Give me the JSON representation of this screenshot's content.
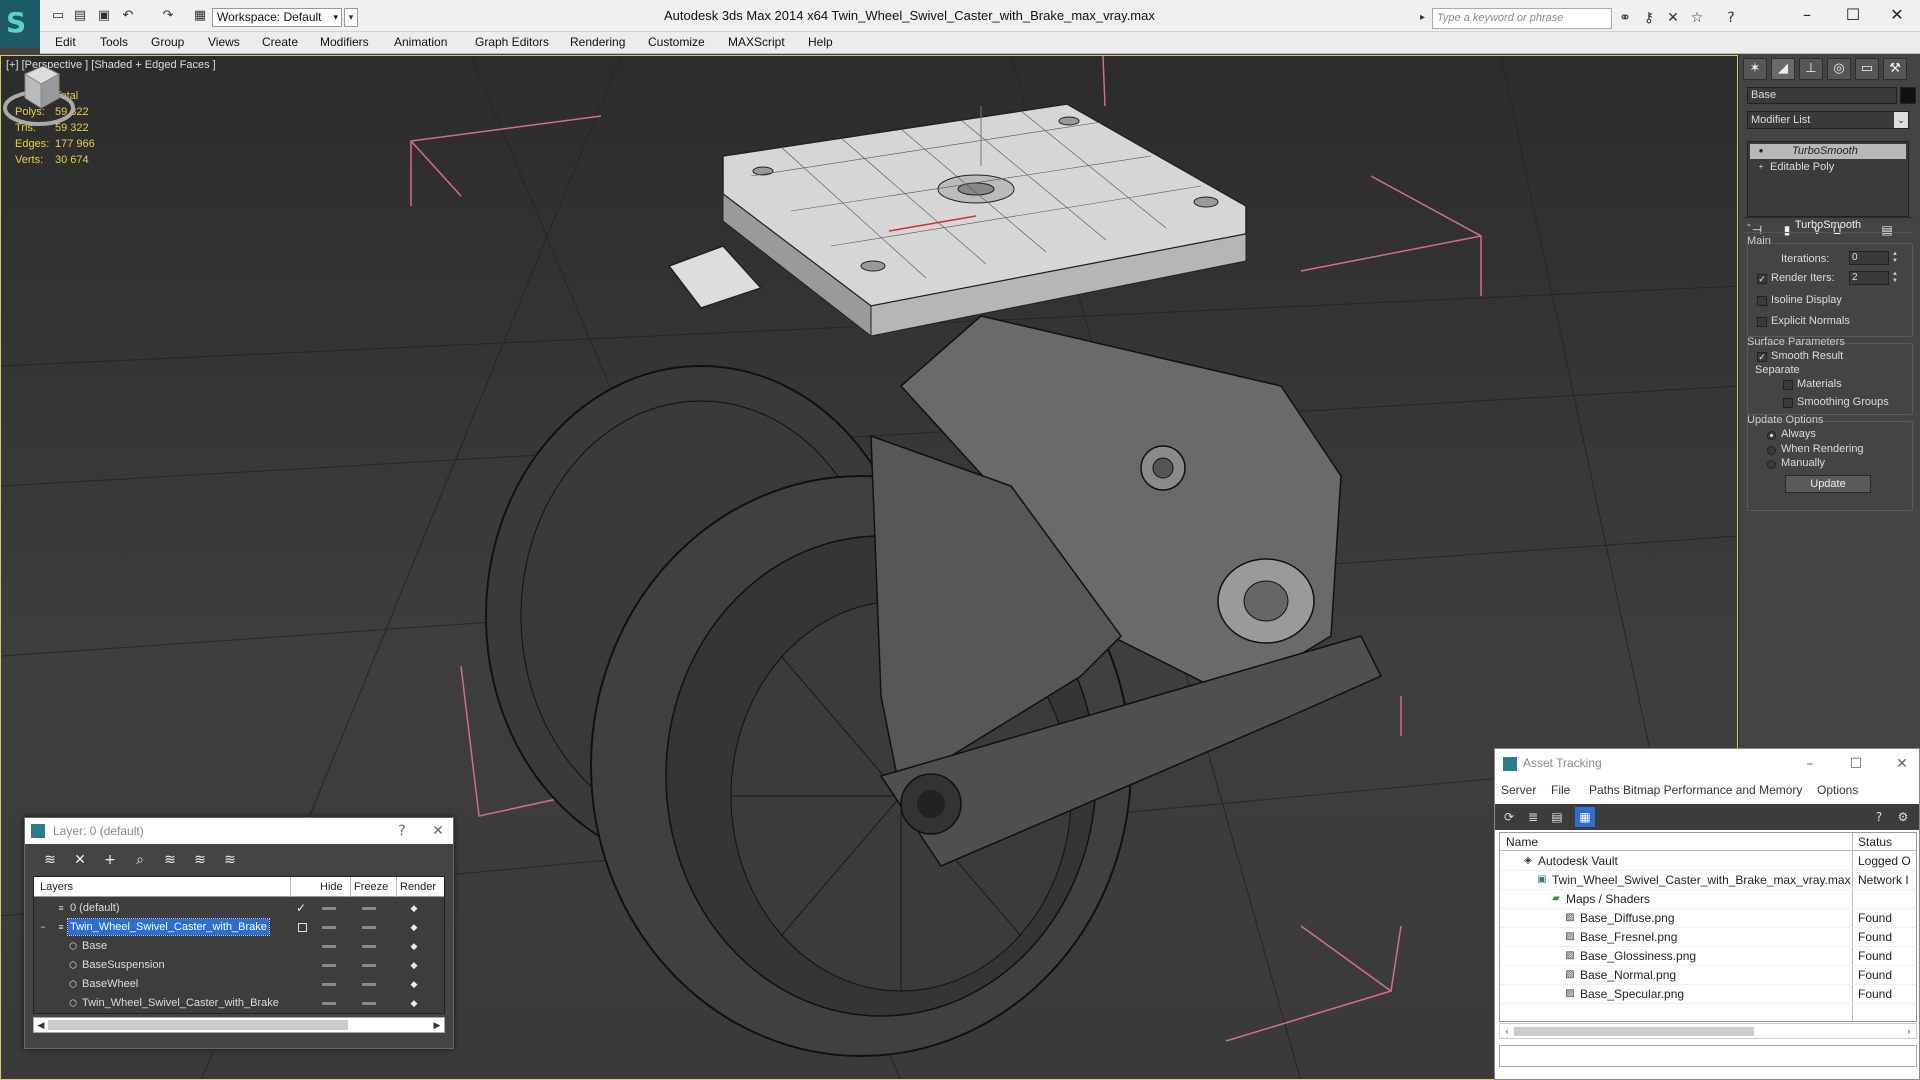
{
  "titlebar": {
    "workspace": "Workspace: Default",
    "title": "Autodesk 3ds Max  2014 x64      Twin_Wheel_Swivel_Caster_with_Brake_max_vray.max",
    "search_placeholder": "Type a keyword or phrase"
  },
  "menu": [
    "Edit",
    "Tools",
    "Group",
    "Views",
    "Create",
    "Modifiers",
    "Animation",
    "Graph Editors",
    "Rendering",
    "Customize",
    "MAXScript",
    "Help"
  ],
  "viewport": {
    "label": "[+] [Perspective ] [Shaded + Edged Faces ]",
    "stats": {
      "header": "Total",
      "rows": [
        {
          "k": "Polys:",
          "v": "59 322"
        },
        {
          "k": "Tris:",
          "v": "59 322"
        },
        {
          "k": "Edges:",
          "v": "177 966"
        },
        {
          "k": "Verts:",
          "v": "30 674"
        }
      ]
    }
  },
  "command_panel": {
    "object_name": "Base",
    "modifier_list": "Modifier List",
    "stack": [
      "TurboSmooth",
      "Editable Poly"
    ],
    "rollout_title": "TurboSmooth",
    "main_label": "Main",
    "iterations_label": "Iterations:",
    "iterations_value": "0",
    "render_iters_label": "Render Iters:",
    "render_iters_value": "2",
    "isoline": "Isoline Display",
    "explicit_normals": "Explicit Normals",
    "surface_params": "Surface Parameters",
    "smooth_result": "Smooth Result",
    "separate": "Separate",
    "materials": "Materials",
    "smoothing_groups": "Smoothing Groups",
    "update_options": "Update Options",
    "always": "Always",
    "when_rendering": "When Rendering",
    "manually": "Manually",
    "update_button": "Update"
  },
  "layer_dialog": {
    "title": "Layer: 0 (default)",
    "help": "?",
    "columns": {
      "layers": "Layers",
      "hide": "Hide",
      "freeze": "Freeze",
      "render": "Render"
    },
    "rows": [
      {
        "name": "0 (default)"
      },
      {
        "name": "Twin_Wheel_Swivel_Caster_with_Brake"
      },
      {
        "name": "Base"
      },
      {
        "name": "BaseSuspension"
      },
      {
        "name": "BaseWheel"
      },
      {
        "name": "Twin_Wheel_Swivel_Caster_with_Brake"
      }
    ]
  },
  "asset_dialog": {
    "title": "Asset Tracking",
    "menu": [
      "Server",
      "File",
      "Paths",
      "Bitmap Performance and Memory",
      "Options"
    ],
    "columns": {
      "name": "Name",
      "status": "Status"
    },
    "rows": [
      {
        "name": "Autodesk Vault",
        "status": "Logged O"
      },
      {
        "name": "Twin_Wheel_Swivel_Caster_with_Brake_max_vray.max",
        "status": "Network I"
      },
      {
        "name": "Maps / Shaders",
        "status": ""
      },
      {
        "name": "Base_Diffuse.png",
        "status": "Found"
      },
      {
        "name": "Base_Fresnel.png",
        "status": "Found"
      },
      {
        "name": "Base_Glossiness.png",
        "status": "Found"
      },
      {
        "name": "Base_Normal.png",
        "status": "Found"
      },
      {
        "name": "Base_Specular.png",
        "status": "Found"
      }
    ]
  },
  "colors": {
    "stats_text": "#e8d23a",
    "selection": "#2a6fd6",
    "viewport_border": "#d9c86a",
    "bounding_box": "#d86a8a"
  }
}
